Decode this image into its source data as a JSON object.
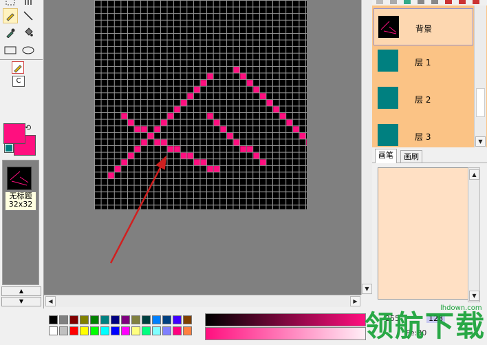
{
  "toolbox": {
    "tools": [
      "select-rect-icon",
      "hand-icon",
      "pencil-icon",
      "line-icon",
      "eyedropper-icon",
      "fill-bucket-icon",
      "rectangle-icon",
      "ellipse-icon"
    ],
    "brush_mode_letter": "C",
    "swap_glyph": "⟲"
  },
  "colors": {
    "foreground": "#ff0f7f",
    "background": "#ff0f7f",
    "accent": "#008080"
  },
  "thumbnail": {
    "title": "无标题",
    "size": "32x32"
  },
  "layers": [
    {
      "name": "背景",
      "active": true
    },
    {
      "name": "层 1",
      "active": false
    },
    {
      "name": "层 2",
      "active": false
    },
    {
      "name": "层 3",
      "active": false
    }
  ],
  "tabs": [
    {
      "label": "画笔",
      "active": true
    },
    {
      "label": "画刷",
      "active": false
    }
  ],
  "palette": {
    "row1": [
      "#000000",
      "#808080",
      "#800000",
      "#808000",
      "#008000",
      "#008080",
      "#000080",
      "#800080",
      "#808040",
      "#004040",
      "#0080ff",
      "#004080",
      "#4000ff",
      "#804000"
    ],
    "row2": [
      "#ffffff",
      "#c0c0c0",
      "#ff0000",
      "#ffff00",
      "#00ff00",
      "#00ffff",
      "#0000ff",
      "#ff00ff",
      "#ffff80",
      "#00ff80",
      "#80ffff",
      "#8080ff",
      "#ff0080",
      "#ff8040"
    ]
  },
  "readouts": {
    "value1": "255",
    "value2": "128",
    "value3": "Fe:80"
  },
  "watermark": {
    "text": "领航下载",
    "site": "lhdown.com"
  },
  "pixels": [
    [
      22,
      5
    ],
    [
      21,
      6
    ],
    [
      20,
      7
    ],
    [
      19,
      8
    ],
    [
      18,
      9
    ],
    [
      17,
      10
    ],
    [
      16,
      11
    ],
    [
      15,
      12
    ],
    [
      14,
      13
    ],
    [
      13,
      14
    ],
    [
      12,
      15
    ],
    [
      11,
      16
    ],
    [
      10,
      17
    ],
    [
      9,
      18
    ],
    [
      8,
      19
    ],
    [
      7,
      20
    ],
    [
      6,
      21
    ],
    [
      5,
      22
    ],
    [
      4,
      23
    ],
    [
      3,
      24
    ],
    [
      2,
      25
    ],
    [
      1,
      26
    ],
    [
      0,
      27
    ],
    [
      3,
      12
    ],
    [
      2,
      13
    ],
    [
      1,
      14
    ],
    [
      0,
      15
    ]
  ],
  "pixels_line_a": [
    [
      17,
      11
    ],
    [
      16,
      12
    ],
    [
      15,
      13
    ],
    [
      14,
      14
    ],
    [
      13,
      15
    ],
    [
      12,
      16
    ],
    [
      11,
      17
    ],
    [
      10,
      18
    ],
    [
      9,
      19
    ],
    [
      8,
      20
    ],
    [
      7,
      21
    ],
    [
      6,
      22
    ],
    [
      5,
      23
    ],
    [
      4,
      24
    ],
    [
      3,
      25
    ],
    [
      2,
      26
    ]
  ],
  "pixels_line_b": [
    [
      21,
      10
    ],
    [
      22,
      11
    ],
    [
      23,
      12
    ],
    [
      24,
      13
    ],
    [
      25,
      14
    ],
    [
      26,
      15
    ],
    [
      27,
      16
    ],
    [
      28,
      17
    ],
    [
      29,
      18
    ],
    [
      30,
      19
    ],
    [
      31,
      20
    ],
    [
      32,
      21
    ]
  ],
  "pixels_line_c": [
    [
      4,
      17
    ],
    [
      5,
      18
    ],
    [
      6,
      19
    ],
    [
      7,
      19
    ],
    [
      8,
      20
    ],
    [
      9,
      21
    ],
    [
      10,
      21
    ],
    [
      11,
      22
    ],
    [
      12,
      22
    ],
    [
      13,
      23
    ],
    [
      14,
      23
    ],
    [
      15,
      24
    ],
    [
      16,
      24
    ],
    [
      17,
      25
    ],
    [
      18,
      25
    ]
  ],
  "pixels_line_d": [
    [
      17,
      17
    ],
    [
      18,
      18
    ],
    [
      19,
      19
    ],
    [
      20,
      20
    ],
    [
      21,
      21
    ],
    [
      22,
      22
    ],
    [
      23,
      22
    ],
    [
      24,
      23
    ],
    [
      25,
      24
    ]
  ]
}
